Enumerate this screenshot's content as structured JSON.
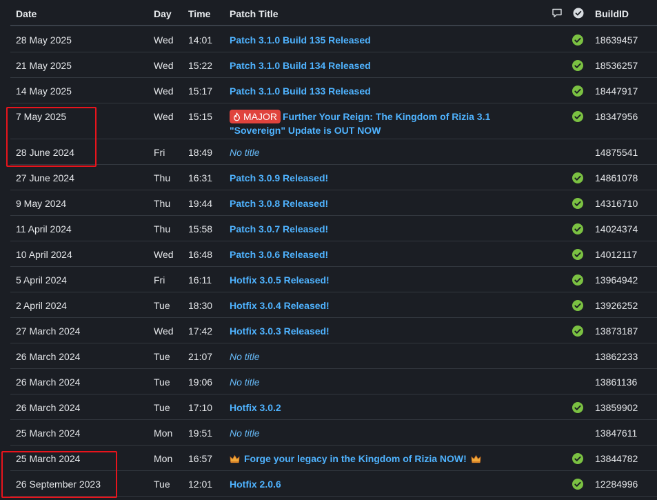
{
  "header": {
    "date": "Date",
    "day": "Day",
    "time": "Time",
    "title": "Patch Title",
    "build": "BuildID",
    "comment_icon": "speech-bubble-icon",
    "check_icon": "check-circle-icon"
  },
  "colors": {
    "background": "#1b1e24",
    "link": "#4fb3ff",
    "badge": "#e0433d",
    "check": "#7bc142",
    "highlight": "#e8141c"
  },
  "rows": [
    {
      "date": "28 May 2025",
      "day": "Wed",
      "time": "14:01",
      "title": "Patch 3.1.0 Build 135 Released",
      "build": "18639457",
      "checked": true
    },
    {
      "date": "21 May 2025",
      "day": "Wed",
      "time": "15:22",
      "title": "Patch 3.1.0 Build 134 Released",
      "build": "18536257",
      "checked": true
    },
    {
      "date": "14 May 2025",
      "day": "Wed",
      "time": "15:17",
      "title": "Patch 3.1.0 Build 133 Released",
      "build": "18447917",
      "checked": true
    },
    {
      "date": "7 May 2025",
      "day": "Wed",
      "time": "15:15",
      "badge": "MAJOR",
      "title": "Further Your Reign: The Kingdom of Rizia 3.1 \"Sovereign\" Update is OUT NOW",
      "build": "18347956",
      "checked": true
    },
    {
      "date": "28 June 2024",
      "day": "Fri",
      "time": "18:49",
      "title": "No title",
      "build": "14875541",
      "checked": false,
      "no_title": true
    },
    {
      "date": "27 June 2024",
      "day": "Thu",
      "time": "16:31",
      "title": "Patch 3.0.9 Released!",
      "build": "14861078",
      "checked": true
    },
    {
      "date": "9 May 2024",
      "day": "Thu",
      "time": "19:44",
      "title": "Patch 3.0.8 Released!",
      "build": "14316710",
      "checked": true
    },
    {
      "date": "11 April 2024",
      "day": "Thu",
      "time": "15:58",
      "title": "Patch 3.0.7 Released!",
      "build": "14024374",
      "checked": true
    },
    {
      "date": "10 April 2024",
      "day": "Wed",
      "time": "16:48",
      "title": "Patch 3.0.6 Released!",
      "build": "14012117",
      "checked": true
    },
    {
      "date": "5 April 2024",
      "day": "Fri",
      "time": "16:11",
      "title": "Hotfix 3.0.5 Released!",
      "build": "13964942",
      "checked": true
    },
    {
      "date": "2 April 2024",
      "day": "Tue",
      "time": "18:30",
      "title": "Hotfix 3.0.4 Released!",
      "build": "13926252",
      "checked": true
    },
    {
      "date": "27 March 2024",
      "day": "Wed",
      "time": "17:42",
      "title": "Hotfix 3.0.3 Released!",
      "build": "13873187",
      "checked": true
    },
    {
      "date": "26 March 2024",
      "day": "Tue",
      "time": "21:07",
      "title": "No title",
      "build": "13862233",
      "checked": false,
      "no_title": true
    },
    {
      "date": "26 March 2024",
      "day": "Tue",
      "time": "19:06",
      "title": "No title",
      "build": "13861136",
      "checked": false,
      "no_title": true
    },
    {
      "date": "26 March 2024",
      "day": "Tue",
      "time": "17:10",
      "title": "Hotfix 3.0.2",
      "build": "13859902",
      "checked": true
    },
    {
      "date": "25 March 2024",
      "day": "Mon",
      "time": "19:51",
      "title": "No title",
      "build": "13847611",
      "checked": false,
      "no_title": true
    },
    {
      "date": "25 March 2024",
      "day": "Mon",
      "time": "16:57",
      "title": "Forge your legacy in the Kingdom of Rizia NOW!",
      "build": "13844782",
      "checked": true,
      "crowns": true
    },
    {
      "date": "26 September 2023",
      "day": "Tue",
      "time": "12:01",
      "title": "Hotfix 2.0.6",
      "build": "12284996",
      "checked": true
    }
  ]
}
